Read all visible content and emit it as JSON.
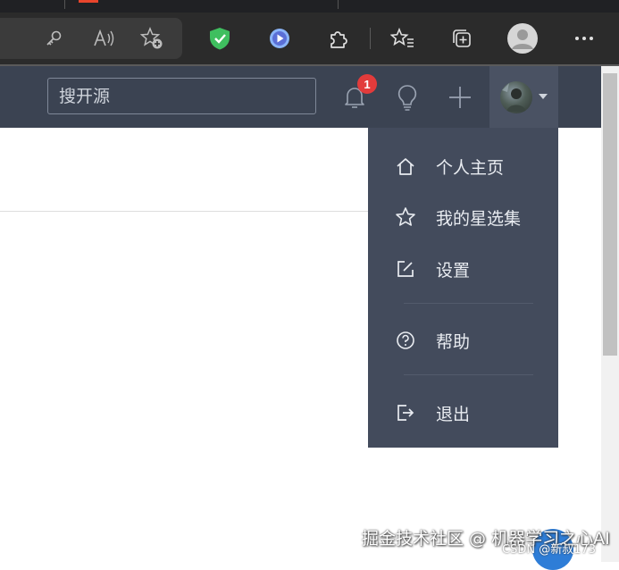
{
  "site_nav": {
    "search_placeholder": "搜开源",
    "notification_count": "1"
  },
  "dropdown": {
    "items": [
      {
        "label": "个人主页",
        "icon": "home-icon"
      },
      {
        "label": "我的星选集",
        "icon": "star-icon"
      },
      {
        "label": "设置",
        "icon": "edit-icon"
      },
      {
        "label": "帮助",
        "icon": "help-circle-icon"
      },
      {
        "label": "退出",
        "icon": "logout-icon"
      }
    ]
  },
  "watermark": {
    "main": "掘金技术社区 @ 机器学习之心AI",
    "small": "CSDN @新叔173"
  },
  "colors": {
    "nav_bg": "#3b4352",
    "dropdown_bg": "#434b5c",
    "badge": "#e23b3b",
    "shield": "#3fbf5f",
    "play": "#8ab4f8"
  }
}
